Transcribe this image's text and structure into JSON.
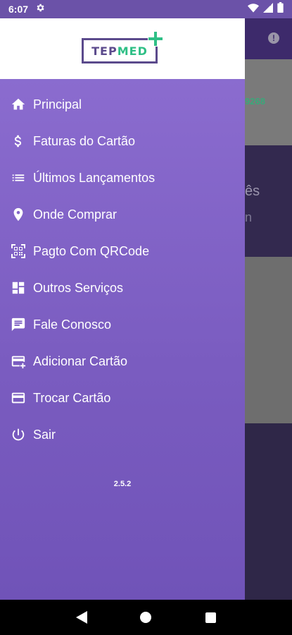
{
  "status_bar": {
    "time": "6:07"
  },
  "background": {
    "partial_number": "9268",
    "partial_text_1": "ês",
    "partial_text_2": "n"
  },
  "drawer": {
    "logo": {
      "part1": "TEP",
      "part2": "MED"
    },
    "items": [
      {
        "label": "Principal",
        "icon": "home-icon"
      },
      {
        "label": "Faturas do Cartão",
        "icon": "dollar-icon"
      },
      {
        "label": "Últimos Lançamentos",
        "icon": "list-icon"
      },
      {
        "label": "Onde Comprar",
        "icon": "location-pin-icon"
      },
      {
        "label": "Pagto Com QRCode",
        "icon": "qrcode-icon"
      },
      {
        "label": "Outros Serviços",
        "icon": "dashboard-icon"
      },
      {
        "label": "Fale Conosco",
        "icon": "chat-icon"
      },
      {
        "label": "Adicionar Cartão",
        "icon": "add-card-icon"
      },
      {
        "label": "Trocar Cartão",
        "icon": "credit-card-icon"
      },
      {
        "label": "Sair",
        "icon": "power-icon"
      }
    ],
    "version": "2.5.2"
  },
  "colors": {
    "drawer_top": "#8e6fd2",
    "drawer_bottom": "#7053b8",
    "brand_green": "#2fbf86",
    "brand_purple": "#5b4a8c"
  }
}
